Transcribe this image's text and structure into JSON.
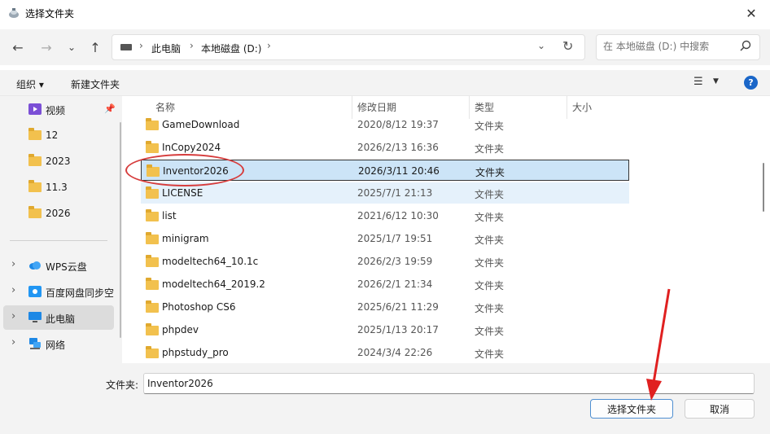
{
  "window": {
    "title": "选择文件夹",
    "close_glyph": "✕"
  },
  "address": {
    "crumbs": [
      "此电脑",
      "本地磁盘 (D:)"
    ],
    "separator": "›",
    "dropdown_glyph": "⌄",
    "refresh_glyph": "↻"
  },
  "search": {
    "placeholder": "在 本地磁盘 (D:) 中搜索",
    "icon": "🔍"
  },
  "toolbar": {
    "organize": "组织 ▾",
    "new_folder": "新建文件夹",
    "help": "?"
  },
  "sidebar": {
    "items": [
      {
        "label": "视频",
        "icon": "video-icon"
      },
      {
        "label": "12",
        "icon": "folder-icon"
      },
      {
        "label": "2023",
        "icon": "folder-icon"
      },
      {
        "label": "11.3",
        "icon": "folder-icon"
      },
      {
        "label": "2026",
        "icon": "folder-icon"
      },
      {
        "label": "WPS云盘",
        "icon": "cloud-icon"
      },
      {
        "label": "百度网盘同步空",
        "icon": "baidu-icon"
      },
      {
        "label": "此电脑",
        "icon": "computer-icon"
      },
      {
        "label": "网络",
        "icon": "network-icon"
      }
    ]
  },
  "columns": {
    "name": "名称",
    "modified": "修改日期",
    "type": "类型",
    "size": "大小"
  },
  "files": [
    {
      "name": "GameDownload",
      "modified": "2020/8/12 19:37",
      "type": "文件夹"
    },
    {
      "name": "InCopy2024",
      "modified": "2026/2/13 16:36",
      "type": "文件夹"
    },
    {
      "name": "Inventor2026",
      "modified": "2026/3/11 20:46",
      "type": "文件夹"
    },
    {
      "name": "LICENSE",
      "modified": "2025/7/1 21:13",
      "type": "文件夹"
    },
    {
      "name": "list",
      "modified": "2021/6/12 10:30",
      "type": "文件夹"
    },
    {
      "name": "minigram",
      "modified": "2025/1/7 19:51",
      "type": "文件夹"
    },
    {
      "name": "modeltech64_10.1c",
      "modified": "2026/2/3 19:59",
      "type": "文件夹"
    },
    {
      "name": "modeltech64_2019.2",
      "modified": "2026/2/1 21:34",
      "type": "文件夹"
    },
    {
      "name": "Photoshop CS6",
      "modified": "2025/6/21 11:29",
      "type": "文件夹"
    },
    {
      "name": "phpdev",
      "modified": "2025/1/13 20:17",
      "type": "文件夹"
    },
    {
      "name": "phpstudy_pro",
      "modified": "2024/3/4 22:26",
      "type": "文件夹"
    }
  ],
  "bottom": {
    "folder_label": "文件夹:",
    "folder_value": "Inventor2026",
    "select_button": "选择文件夹",
    "cancel_button": "取消"
  },
  "colors": {
    "selection": "#cce4f7",
    "hover": "#e5f1fb",
    "annotation": "#d63c3c",
    "accent": "#1a66c8"
  }
}
